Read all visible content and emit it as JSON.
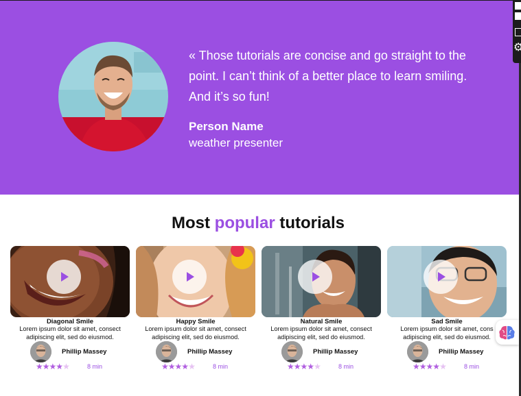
{
  "hero": {
    "quote": "« Those tutorials are concise and go straight to the point. I can’t think of a better place to learn smiling. And it’s so fun!",
    "person_name": "Person Name",
    "person_role": "weather presenter",
    "background_color": "#9b4fe2"
  },
  "section": {
    "title_before": "Most",
    "title_accent": "popular",
    "title_after": "tutorials",
    "accent_color": "#9b4fe2"
  },
  "cards": [
    {
      "title": "Diagonal Smile",
      "desc_line1": "Lorem ipsum dolor sit amet, consect",
      "desc_line2": "adipiscing elit, sed do eiusmod.",
      "author": "Phillip Massey",
      "rating": 4,
      "rating_max": 5,
      "duration": "8 min"
    },
    {
      "title": "Happy Smile",
      "desc_line1": "Lorem ipsum dolor sit amet, consect",
      "desc_line2": "adipiscing elit, sed do eiusmod.",
      "author": "Phillip Massey",
      "rating": 4,
      "rating_max": 5,
      "duration": "8 min"
    },
    {
      "title": "Natural Smile",
      "desc_line1": "Lorem ipsum dolor sit amet, consect",
      "desc_line2": "adipiscing elit, sed do eiusmod.",
      "author": "Phillip Massey",
      "rating": 4,
      "rating_max": 5,
      "duration": "8 min"
    },
    {
      "title": "Sad Smile",
      "desc_line1": "Lorem ipsum dolor sit amet, cons",
      "desc_line2": "adipiscing elit, sed do eiusmod.",
      "author": "Phillip Massey",
      "rating": 4,
      "rating_max": 5,
      "duration": "8 min"
    }
  ],
  "icons": {
    "play": "play-icon",
    "star": "star-icon",
    "gear": "gear-icon",
    "brain": "brain-icon"
  }
}
